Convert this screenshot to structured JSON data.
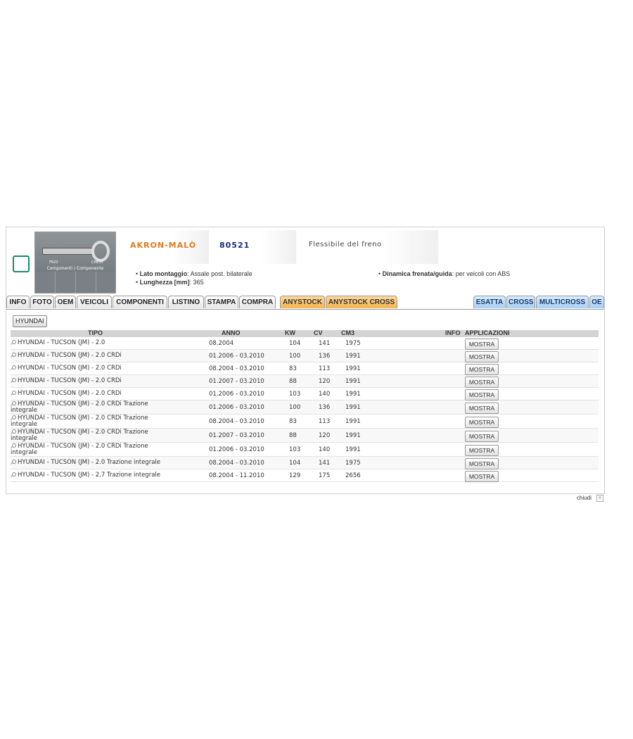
{
  "product": {
    "brand": "AKRON-MALÒ",
    "code": "80521",
    "description": "Flessibile del freno",
    "image": {
      "label": "Componenti / Componente",
      "code_left": "FR22",
      "code_right": "CHE31"
    },
    "specs_left": [
      {
        "label": "Lato montaggio",
        "value": ": Assale post. bilaterale"
      },
      {
        "label": "Lunghezza [mm]",
        "value": ": 365"
      }
    ],
    "specs_right": [
      {
        "label": "Dinamica frenata/guida",
        "value": ": per veicoli con ABS"
      }
    ]
  },
  "tabs_left": [
    "INFO",
    "FOTO",
    "OEM",
    "VEICOLI",
    "COMPONENTI",
    "LISTINO",
    "STAMPA",
    "COMPRA"
  ],
  "tabs_orange": [
    "ANYSTOCK",
    "ANYSTOCK CROSS"
  ],
  "tabs_right": [
    "ESATTA",
    "CROSS",
    "MULTICROSS",
    "OE"
  ],
  "brand_filter": "HYUNDAI",
  "table": {
    "headers": {
      "tipo": "TIPO",
      "anno": "ANNO",
      "kw": "KW",
      "cv": "CV",
      "cm3": "CM3",
      "info": "INFO",
      "applicazioni": "APPLICAZIONI"
    },
    "rows": [
      {
        "tipo": "HYUNDAI - TUCSON (JM) - 2.0",
        "anno": "08.2004",
        "kw": "104",
        "cv": "141",
        "cm3": "1975",
        "action": "MOSTRA"
      },
      {
        "tipo": "HYUNDAI - TUCSON (JM) - 2.0 CRDi",
        "anno": "01.2006 - 03.2010",
        "kw": "100",
        "cv": "136",
        "cm3": "1991",
        "action": "MOSTRA"
      },
      {
        "tipo": "HYUNDAI - TUCSON (JM) - 2.0 CRDi",
        "anno": "08.2004 - 03.2010",
        "kw": "83",
        "cv": "113",
        "cm3": "1991",
        "action": "MOSTRA"
      },
      {
        "tipo": "HYUNDAI - TUCSON (JM) - 2.0 CRDi",
        "anno": "01.2007 - 03.2010",
        "kw": "88",
        "cv": "120",
        "cm3": "1991",
        "action": "MOSTRA"
      },
      {
        "tipo": "HYUNDAI - TUCSON (JM) - 2.0 CRDi",
        "anno": "01.2006 - 03.2010",
        "kw": "103",
        "cv": "140",
        "cm3": "1991",
        "action": "MOSTRA"
      },
      {
        "tipo": "HYUNDAI - TUCSON (JM) - 2.0 CRDi Trazione integrale",
        "anno": "01.2006 - 03.2010",
        "kw": "100",
        "cv": "136",
        "cm3": "1991",
        "action": "MOSTRA"
      },
      {
        "tipo": "HYUNDAI - TUCSON (JM) - 2.0 CRDi Trazione integrale",
        "anno": "08.2004 - 03.2010",
        "kw": "83",
        "cv": "113",
        "cm3": "1991",
        "action": "MOSTRA"
      },
      {
        "tipo": "HYUNDAI - TUCSON (JM) - 2.0 CRDi Trazione integrale",
        "anno": "01.2007 - 03.2010",
        "kw": "88",
        "cv": "120",
        "cm3": "1991",
        "action": "MOSTRA"
      },
      {
        "tipo": "HYUNDAI - TUCSON (JM) - 2.0 CRDi Trazione integrale",
        "anno": "01.2006 - 03.2010",
        "kw": "103",
        "cv": "140",
        "cm3": "1991",
        "action": "MOSTRA"
      },
      {
        "tipo": "HYUNDAI - TUCSON (JM) - 2.0 Trazione integrale",
        "anno": "08.2004 - 03.2010",
        "kw": "104",
        "cv": "141",
        "cm3": "1975",
        "action": "MOSTRA"
      },
      {
        "tipo": "HYUNDAI - TUCSON (JM) - 2.7 Trazione integrale",
        "anno": "08.2004 - 11.2010",
        "kw": "129",
        "cv": "175",
        "cm3": "2656",
        "action": "MOSTRA"
      }
    ]
  },
  "footer": {
    "close_label": "chiudi",
    "close_glyph": "x"
  }
}
